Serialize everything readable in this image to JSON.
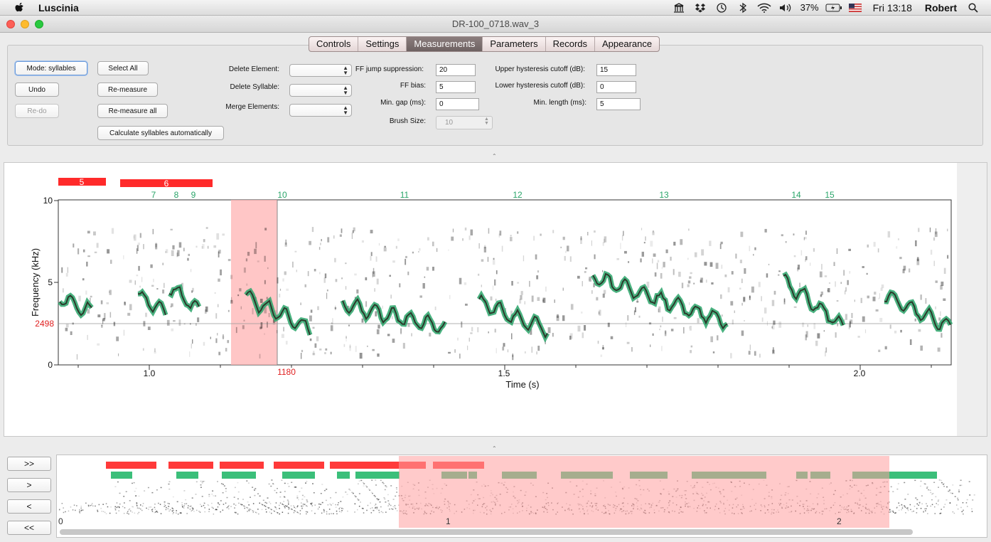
{
  "menubar": {
    "app_name": "Luscinia",
    "battery": "37%",
    "clock": "Fri 13:18",
    "user": "Robert",
    "icons": [
      "apple-icon",
      "building-icon",
      "dropbox-icon",
      "time-machine-icon",
      "bluetooth-icon",
      "wifi-icon",
      "volume-icon",
      "battery-icon",
      "flag-icon",
      "search-icon"
    ]
  },
  "window": {
    "title": "DR-100_0718.wav_3",
    "traffic_colors": [
      "#fd5f57",
      "#febb2e",
      "#29c940"
    ]
  },
  "tabs": [
    {
      "label": "Controls",
      "active": false
    },
    {
      "label": "Settings",
      "active": false
    },
    {
      "label": "Measurements",
      "active": true
    },
    {
      "label": "Parameters",
      "active": false
    },
    {
      "label": "Records",
      "active": false
    },
    {
      "label": "Appearance",
      "active": false
    }
  ],
  "buttons": {
    "mode": "Mode: syllables",
    "select_all": "Select All",
    "undo": "Undo",
    "remeasure": "Re-measure",
    "redo": "Re-do",
    "remeasure_all": "Re-measure all",
    "calc_auto": "Calculate syllables automatically"
  },
  "combos": {
    "delete_element": "Delete Element:",
    "delete_syllable": "Delete Syllable:",
    "merge_elements": "Merge Elements:"
  },
  "params": {
    "ff_jump_label": "FF jump suppression:",
    "ff_jump_value": "20",
    "ff_bias_label": "FF bias:",
    "ff_bias_value": "5",
    "min_gap_label": "Min. gap (ms):",
    "min_gap_value": "0",
    "brush_label": "Brush Size:",
    "brush_value": "10",
    "upper_label": "Upper hysteresis cutoff (dB):",
    "upper_value": "15",
    "lower_label": "Lower hysteresis cutoff (dB):",
    "lower_value": "0",
    "minlen_label": "Min. length (ms):",
    "minlen_value": "5"
  },
  "spectrogram": {
    "ylabel": "Frequency (kHz)",
    "xlabel": "Time (s)",
    "y_ticks": [
      "10",
      "5",
      "0"
    ],
    "x_ticks": [
      "1.0",
      "1.5",
      "2.0"
    ],
    "cursor_freq": "2498",
    "cursor_time": "1180",
    "syllables": [
      "5",
      "6"
    ],
    "elements": [
      "7",
      "8",
      "9",
      "10",
      "11",
      "12",
      "13",
      "14",
      "15"
    ],
    "colors": {
      "syllable": "#ff2a2a",
      "element": "#2aa56a",
      "selection": "#ffb3b3",
      "cursor": "#e02020"
    }
  },
  "overview": {
    "nav_buttons": [
      ">>",
      ">",
      "<",
      "<<"
    ],
    "x_ticks": [
      "0",
      "1",
      "2"
    ]
  }
}
